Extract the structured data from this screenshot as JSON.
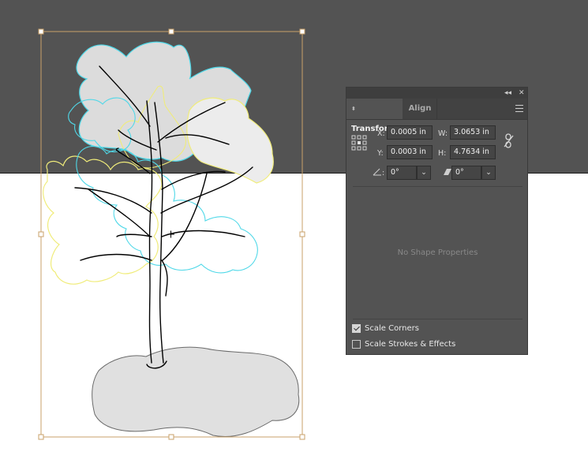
{
  "panel": {
    "collapse_icon": "double-chevron-left-icon",
    "close_icon": "close-icon",
    "tabs": [
      {
        "label": "Transform",
        "active": true
      },
      {
        "label": "Align",
        "active": false
      }
    ],
    "menu_icon": "hamburger-menu-icon",
    "x_label": "X:",
    "x_value": "0.0005 in",
    "y_label": "Y:",
    "y_value": "0.0003 in",
    "w_label": "W:",
    "w_value": "3.0653 in",
    "h_label": "H:",
    "h_value": "4.7634 in",
    "rotate_label": ":",
    "rotate_value": "0°",
    "shear_label": ":",
    "shear_value": "0°",
    "no_shape_text": "No Shape Properties",
    "scale_corners_label": "Scale Corners",
    "scale_corners_checked": true,
    "scale_strokes_label": "Scale Strokes & Effects",
    "scale_strokes_checked": false
  },
  "colors": {
    "canvas_dark": "#535353",
    "selection_box": "#c8a06a",
    "cyan_outline": "#4fd8e8",
    "yellow_outline": "#f0ec7a",
    "foliage_fill": "#dcdcdc",
    "ground_fill": "#e0e0e0"
  }
}
